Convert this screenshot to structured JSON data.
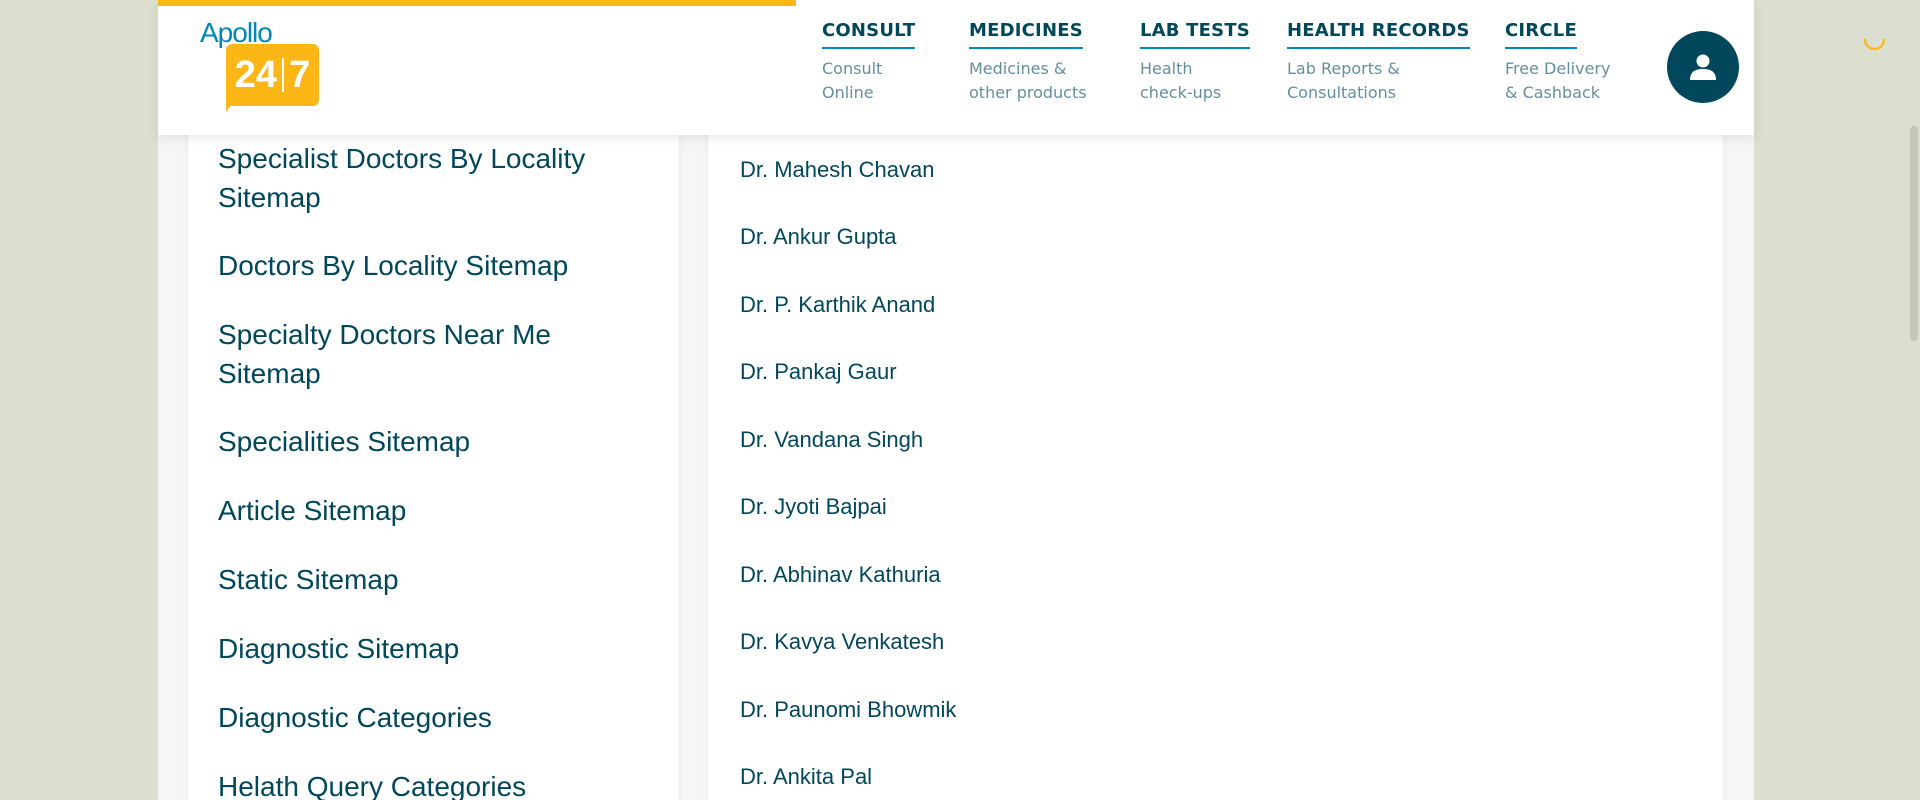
{
  "header": {
    "logo": {
      "brand": "Apollo",
      "digits_left": "24",
      "digits_right": "7"
    },
    "nav": [
      {
        "title": "CONSULT",
        "sub1": "Consult",
        "sub2": "Online"
      },
      {
        "title": "MEDICINES",
        "sub1": "Medicines &",
        "sub2": "other products"
      },
      {
        "title": "LAB TESTS",
        "sub1": "Health",
        "sub2": "check-ups"
      },
      {
        "title": "HEALTH RECORDS",
        "sub1": "Lab Reports &",
        "sub2": "Consultations"
      },
      {
        "title": "CIRCLE",
        "sub1": "Free Delivery",
        "sub2": "& Cashback"
      }
    ],
    "avatar_icon": "user-icon",
    "spinner_icon": "loading-spinner-icon",
    "progress_percent": 40
  },
  "sidebar": {
    "links": [
      "Specialist Doctors By Locality Sitemap",
      "Doctors By Locality Sitemap",
      "Specialty Doctors Near Me Sitemap",
      "Specialities Sitemap",
      "Article Sitemap",
      "Static Sitemap",
      "Diagnostic Sitemap",
      "Diagnostic Categories",
      "Helath Query Categories"
    ]
  },
  "doctors": {
    "items": [
      "Dr. Mahesh Chavan",
      "Dr. Ankur Gupta",
      "Dr. P. Karthik Anand",
      "Dr. Pankaj Gaur",
      "Dr. Vandana Singh",
      "Dr. Jyoti Bajpai",
      "Dr. Abhinav Kathuria",
      "Dr. Kavya Venkatesh",
      "Dr. Paunomi Bhowmik",
      "Dr. Ankita Pal"
    ]
  },
  "colors": {
    "brand_blue": "#0087ba",
    "brand_yellow": "#fcb716",
    "text_dark": "#01475b",
    "text_muted": "#658f9b",
    "page_bg": "#dcdfcf"
  }
}
